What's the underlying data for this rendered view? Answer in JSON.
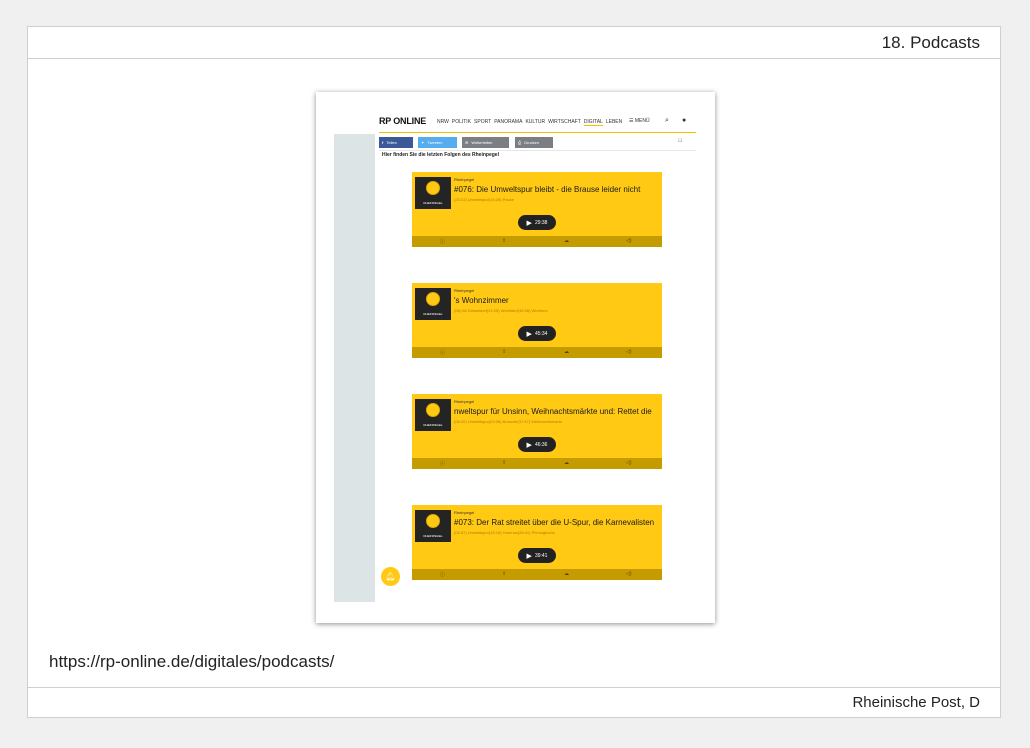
{
  "slide": {
    "title": "18. Podcasts",
    "url": "https://rp-online.de/digitales/podcasts/",
    "source": "Rheinische Post, D"
  },
  "site": {
    "logo": "RP ONLINE",
    "nav_items": [
      "NRW",
      "POLITIK",
      "SPORT",
      "PANORAMA",
      "KULTUR",
      "WIRTSCHAFT",
      "DIGITAL",
      "LEBEN"
    ],
    "active_nav": "DIGITAL",
    "menu_label": "MENÜ",
    "share": {
      "facebook": "Teilen",
      "twitter": "Tweeten",
      "email": "Weiterleiten",
      "print": "Drucken"
    },
    "intro": "Hier finden Sie die letzten Folgen des Rheinpegel",
    "players": [
      {
        "channel": "Rheinpegel",
        "title": "#076: Die Umweltspur bleibt - die Brause leider nicht",
        "meta": "(23:31) Umweltspur(15:25) Pause",
        "duration": "29:38"
      },
      {
        "channel": "Rheinpegel",
        "title": "'s Wohnzimmer",
        "meta": "(08) Alt Düsseldorf(21:05) Wohlfahrt(32:56) Wurthers",
        "duration": "45:34"
      },
      {
        "channel": "Rheinpegel",
        "title": "nweltspur für Unsinn, Weihnachtsmärkte und: Rettet die",
        "meta": "(04:20) Umweltspur(22:38) Brosche(37:47) Weihnachtsmarkt",
        "duration": "46:36"
      },
      {
        "channel": "Rheinpegel",
        "title": "#073: Der Rat streitet über die U-Spur, die Karnevalisten",
        "meta": "(04:57) Umweltspur(15:18) Hoerrow(28:41) Pfennigfuchs",
        "duration": "39:41"
      }
    ],
    "thumb_brand": "RHEINPEGEL"
  },
  "colors": {
    "accent": "#ffc914",
    "player_bar": "#c59c00",
    "facebook": "#3b5998",
    "twitter": "#55acee",
    "email": "#7b7f83",
    "print": "#7b7f83"
  }
}
